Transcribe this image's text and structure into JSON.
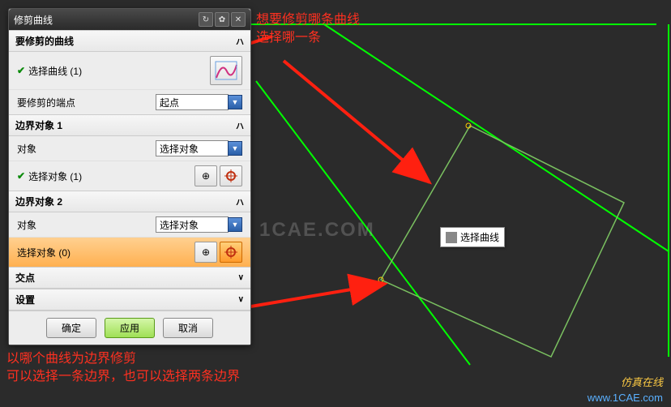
{
  "dialog": {
    "title": "修剪曲线",
    "section_main": "要修剪的曲线",
    "select_curve_label": "选择曲线 (1)",
    "endpoint_label": "要修剪的端点",
    "endpoint_value": "起点",
    "boundary1_head": "边界对象 1",
    "obj_label": "对象",
    "obj_value": "选择对象",
    "select_obj1_label": "选择对象 (1)",
    "boundary2_head": "边界对象 2",
    "select_obj2_label": "选择对象 (0)",
    "intersect_head": "交点",
    "settings_head": "设置",
    "ok": "确定",
    "apply": "应用",
    "cancel": "取消"
  },
  "tooltip": {
    "text": "选择曲线"
  },
  "annotations": {
    "a1_line1": "想要修剪哪条曲线",
    "a1_line2": "选择哪一条",
    "a2_line1": "以哪个曲线为边界修剪",
    "a2_line2": "可以选择一条边界，也可以选择两条边界"
  },
  "watermark": {
    "big": "1CAE.COM",
    "brand": "仿真在线",
    "url": "www.1CAE.com"
  }
}
